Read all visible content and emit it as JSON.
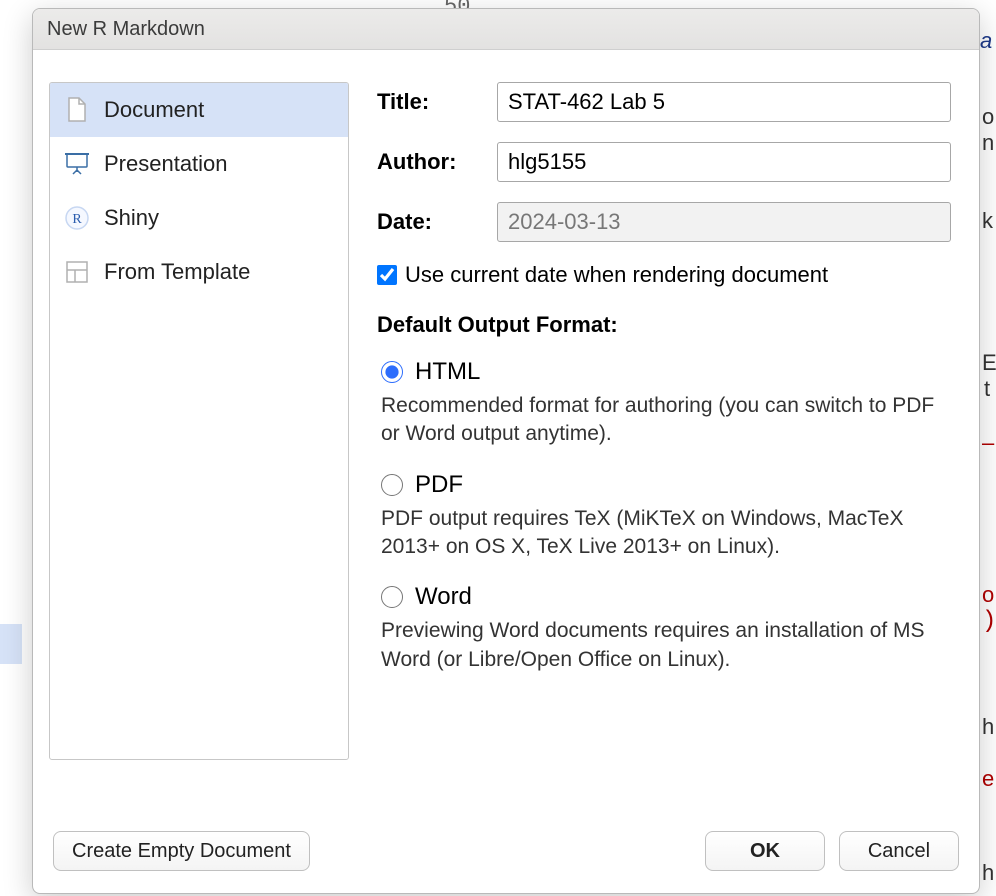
{
  "dialog": {
    "title": "New R Markdown"
  },
  "sidebar": {
    "items": [
      {
        "label": "Document"
      },
      {
        "label": "Presentation"
      },
      {
        "label": "Shiny"
      },
      {
        "label": "From Template"
      }
    ]
  },
  "form": {
    "title_label": "Title:",
    "title_value": "STAT-462 Lab 5",
    "author_label": "Author:",
    "author_value": "hlg5155",
    "date_label": "Date:",
    "date_value": "2024-03-13",
    "use_current_date_label": "Use current date when rendering document",
    "use_current_date_checked": true,
    "output_section_label": "Default Output Format:",
    "options": [
      {
        "name": "HTML",
        "desc": "Recommended format for authoring (you can switch to PDF or Word output anytime).",
        "selected": true
      },
      {
        "name": "PDF",
        "desc": "PDF output requires TeX (MiKTeX on Windows, MacTeX 2013+ on OS X, TeX Live 2013+ on Linux).",
        "selected": false
      },
      {
        "name": "Word",
        "desc": "Previewing Word documents requires an installation of MS Word (or Libre/Open Office on Linux).",
        "selected": false
      }
    ]
  },
  "footer": {
    "create_empty": "Create Empty Document",
    "ok": "OK",
    "cancel": "Cancel"
  },
  "background": {
    "f50": "50",
    "a": "a",
    "o1": "o",
    "n": "n",
    "k": "k",
    "E": "E",
    "t": "t",
    "dash": "–",
    "o2": "o",
    "paren": ")",
    "h1": "h",
    "e": "e",
    "h2": "h"
  }
}
